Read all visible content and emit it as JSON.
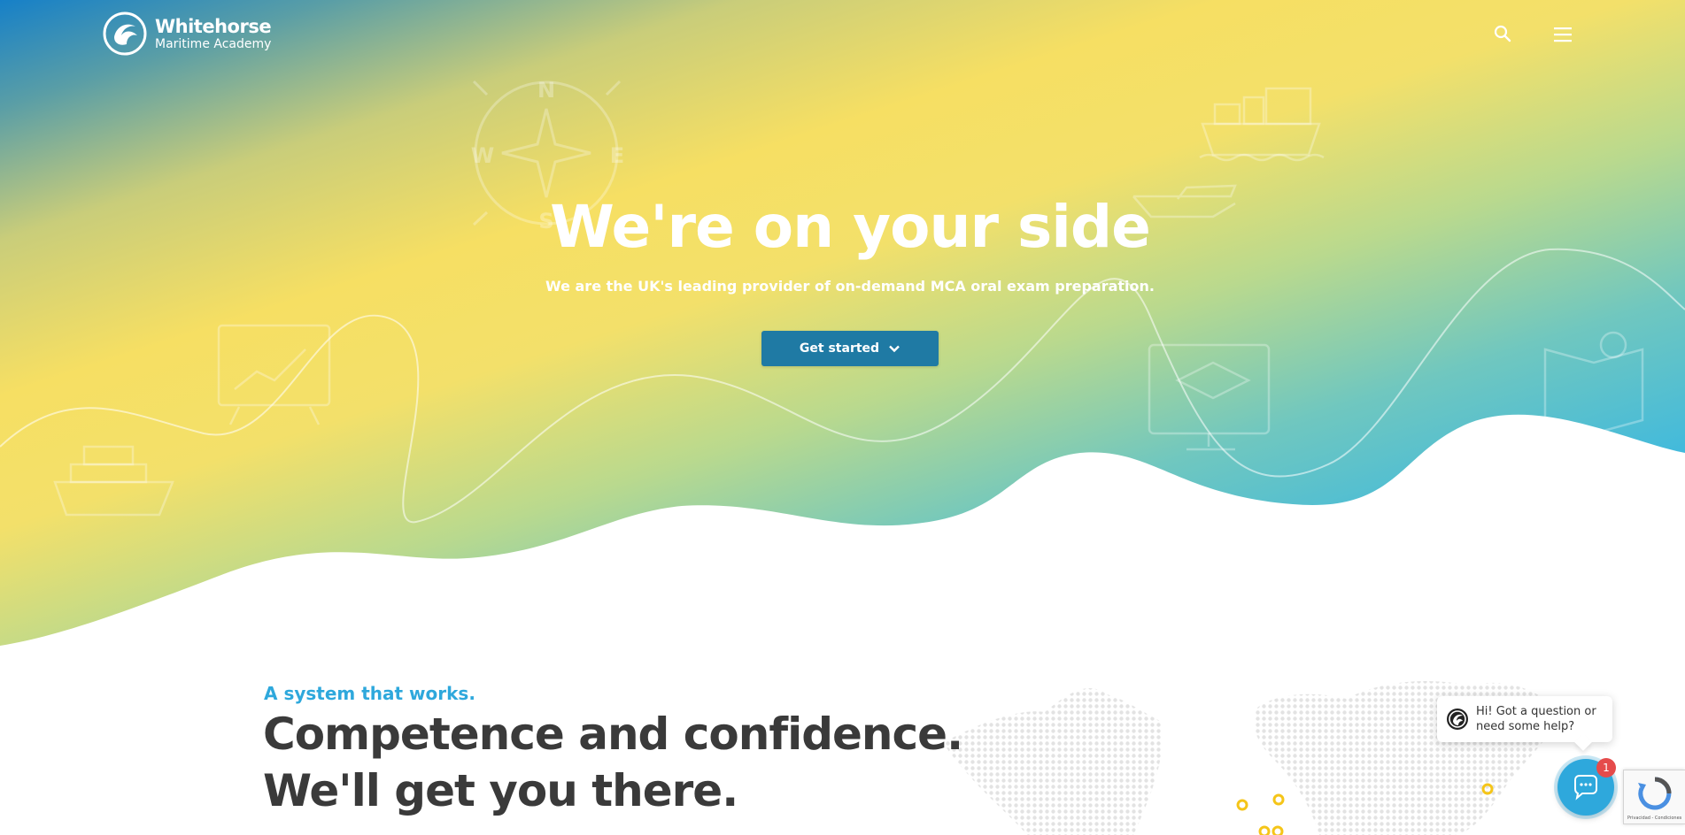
{
  "brand": {
    "name": "Whitehorse",
    "tagline": "Maritime Academy"
  },
  "header": {
    "search_icon": "search-icon",
    "menu_icon": "hamburger-menu-icon"
  },
  "hero": {
    "title": "We're on your side",
    "subtitle": "We are the UK's leading provider of on-demand MCA oral exam preparation.",
    "cta_label": "Get started",
    "compass_letters": [
      "N",
      "E",
      "S",
      "W"
    ]
  },
  "intro": {
    "eyebrow": "A system that works.",
    "headline_line1": "Competence and confidence.",
    "headline_line2": "We'll get you there."
  },
  "chat": {
    "message": "Hi! Got a question or need some help?",
    "unread_count": "1"
  },
  "recaptcha": {
    "text": "Privacidad - Condiciones"
  },
  "colors": {
    "accent_blue": "#2ea8dc",
    "button_blue": "#1f7aa4",
    "hero_yellow": "#f6df63",
    "hero_top_blue": "#1680c8",
    "headline_text": "#3a3a3a",
    "map_dot_yellow": "#f5c518"
  }
}
